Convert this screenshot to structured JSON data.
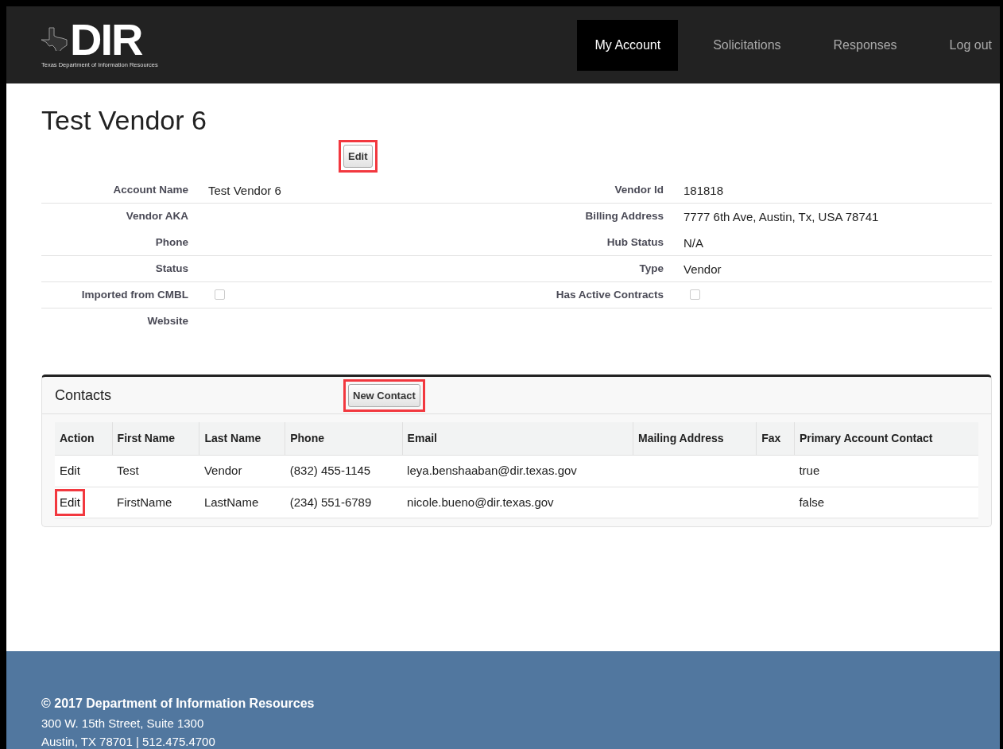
{
  "header": {
    "logo": {
      "letters": "DIR",
      "tagline": "Texas Department of Information Resources"
    },
    "nav": [
      {
        "label": "My Account",
        "selected": true
      },
      {
        "label": "Solicitations",
        "selected": false
      },
      {
        "label": "Responses",
        "selected": false
      },
      {
        "label": "Log out",
        "selected": false
      }
    ]
  },
  "title": "Test Vendor 6",
  "edit_button": {
    "label": "Edit",
    "highlighted": true
  },
  "details": [
    {
      "left": {
        "label": "Account Name",
        "kind": "text",
        "value": "Test Vendor 6"
      },
      "right": {
        "label": "Vendor Id",
        "kind": "text",
        "value": "181818"
      },
      "divider": true
    },
    {
      "left": {
        "label": "Vendor AKA",
        "kind": "text"
      },
      "right": {
        "label": "Billing Address",
        "kind": "text",
        "value": "7777 6th Ave, Austin, Tx, USA 78741"
      },
      "divider": false
    },
    {
      "left": {
        "label": "Phone",
        "kind": "text"
      },
      "right": {
        "label": "Hub Status",
        "kind": "text",
        "value": "N/A"
      },
      "divider": true
    },
    {
      "left": {
        "label": "Status",
        "kind": "text"
      },
      "right": {
        "label": "Type",
        "kind": "text",
        "value": "Vendor"
      },
      "divider": true
    },
    {
      "left": {
        "label": "Imported from CMBL",
        "kind": "checkbox",
        "checked": false
      },
      "right": {
        "label": "Has Active Contracts",
        "kind": "checkbox",
        "checked": false
      },
      "divider": true
    },
    {
      "left": {
        "label": "Website",
        "kind": "text"
      },
      "divider": false
    }
  ],
  "contacts": {
    "title": "Contacts",
    "new_button": {
      "label": "New Contact",
      "highlighted": true
    },
    "columns": [
      "Action",
      "First Name",
      "Last Name",
      "Phone",
      "Email",
      "Mailing Address",
      "Fax",
      "Primary Account Contact"
    ],
    "rows": [
      {
        "highlighted": false,
        "cells": [
          "Edit",
          "Test",
          "Vendor",
          "(832) 455-1145",
          "leya.benshaaban@dir.texas.gov",
          "",
          "",
          "true"
        ]
      },
      {
        "highlighted": true,
        "cells": [
          "Edit",
          "FirstName",
          "LastName",
          "(234) 551-6789",
          "nicole.bueno@dir.texas.gov",
          "",
          "",
          "false"
        ]
      }
    ]
  },
  "footer": {
    "copyright": "© 2017 Department of Information Resources",
    "address": "300 W. 15th Street, Suite 1300",
    "city": "Austin, TX 78701 | 512.475.4700"
  }
}
